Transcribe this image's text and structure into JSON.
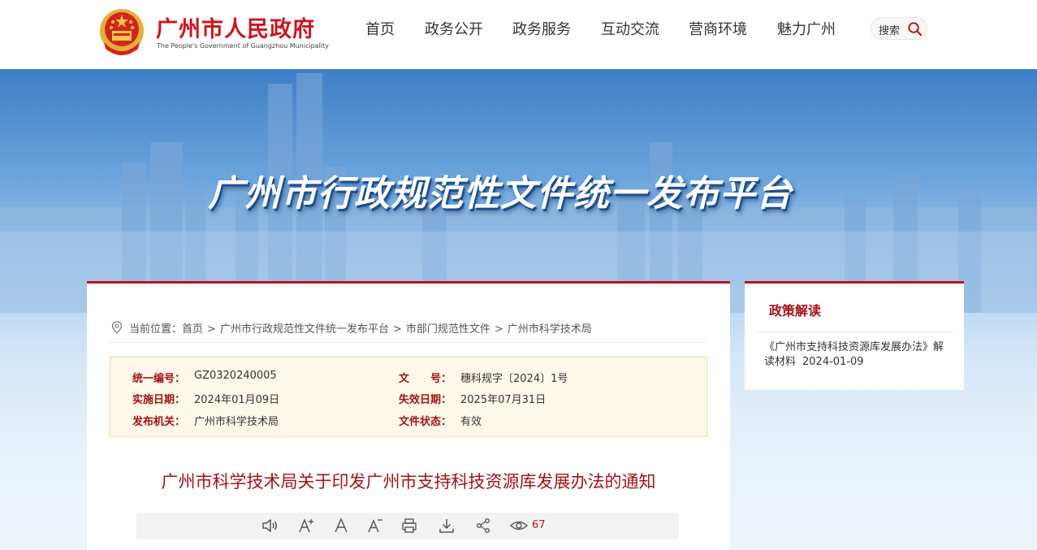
{
  "header": {
    "site_name": "广州市人民政府",
    "site_name_en": "The People's Government of Guangzhou Municipality",
    "nav": [
      "首页",
      "政务公开",
      "政务服务",
      "互动交流",
      "营商环境",
      "魅力广州"
    ],
    "search_label": "搜索"
  },
  "banner": {
    "title": "广州市行政规范性文件统一发布平台"
  },
  "breadcrumb": {
    "prefix": "当前位置：",
    "items": [
      "首页",
      "广州市行政规范性文件统一发布平台",
      "市部门规范性文件",
      "广州市科学技术局"
    ]
  },
  "meta": {
    "serial_label": "统一编号：",
    "serial_value": "GZ0320240005",
    "docno_label": "文　　号：",
    "docno_value": "穗科规字〔2024〕1号",
    "effective_label": "实施日期：",
    "effective_value": "2024年01月09日",
    "expiry_label": "失效日期：",
    "expiry_value": "2025年07月31日",
    "issuer_label": "发布机关：",
    "issuer_value": "广州市科学技术局",
    "status_label": "文件状态：",
    "status_value": "有效"
  },
  "document": {
    "title": "广州市科学技术局关于印发广州市支持科技资源库发展办法的通知"
  },
  "toolbar": {
    "view_count": "67"
  },
  "side": {
    "title": "政策解读",
    "link_text": "《广州市支持科技资源库发展办法》解读材料",
    "link_date": "2024-01-09"
  },
  "colors": {
    "brand_red": "#b5141b",
    "title_red": "#a01418",
    "meta_bg": "#fef8e8"
  }
}
